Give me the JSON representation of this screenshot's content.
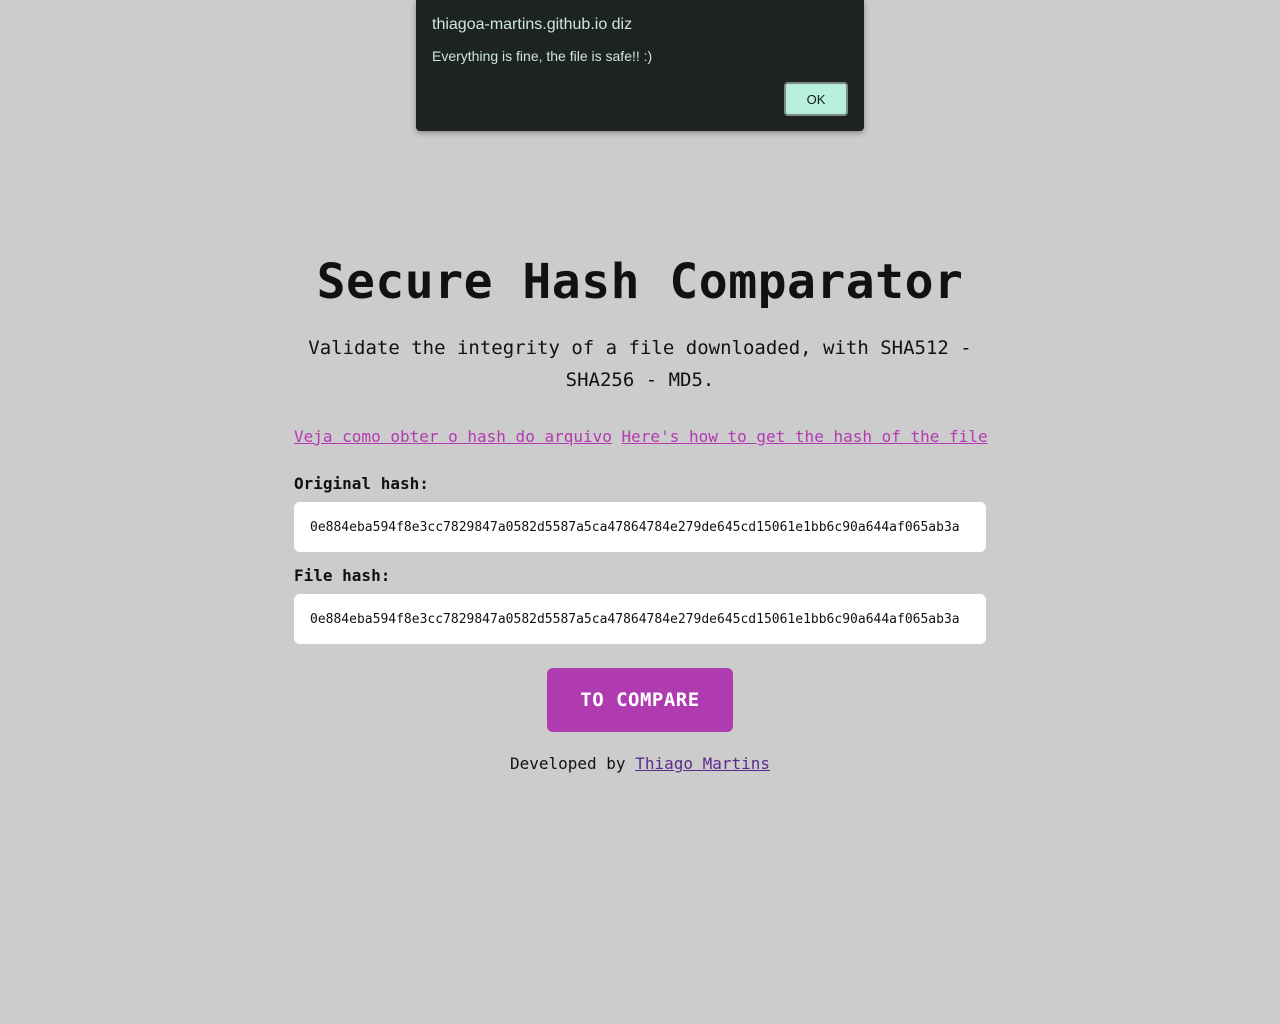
{
  "alert": {
    "title": "thiagoa-martins.github.io diz",
    "message": "Everything is fine, the file is safe!! :)",
    "ok_label": "OK"
  },
  "header": {
    "title": "Secure Hash Comparator",
    "subtitle": "Validate the integrity of a file downloaded, with SHA512 - SHA256 - MD5."
  },
  "links": {
    "pt_label": "Veja como obter o hash do arquivo",
    "en_label": "Here's how to get the hash of the file"
  },
  "form": {
    "original_label": "Original hash:",
    "original_value": "0e884eba594f8e3cc7829847a0582d5587a5ca47864784e279de645cd15061e1bb6c90a644af065ab3a",
    "file_label": "File hash:",
    "file_value": "0e884eba594f8e3cc7829847a0582d5587a5ca47864784e279de645cd15061e1bb6c90a644af065ab3a",
    "compare_label": "TO COMPARE"
  },
  "footer": {
    "prefix": "Developed by",
    "author": "Thiago Martins"
  },
  "colors": {
    "background": "#cccccc",
    "accent": "#b03ab0",
    "link": "#b33ab3",
    "author_link": "#5b2b8c",
    "dialog_bg": "#1c2321",
    "ok_button": "#b7f0dc"
  }
}
